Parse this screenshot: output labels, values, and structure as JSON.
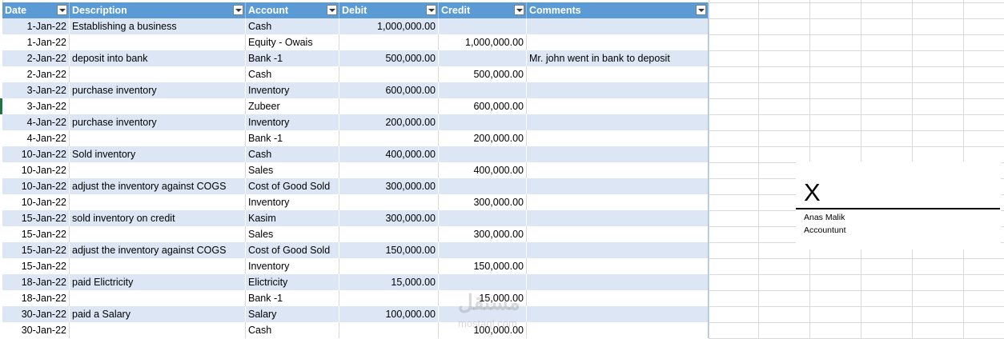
{
  "columns": [
    {
      "key": "date",
      "label": "Date"
    },
    {
      "key": "description",
      "label": "Description"
    },
    {
      "key": "account",
      "label": "Account"
    },
    {
      "key": "debit",
      "label": "Debit"
    },
    {
      "key": "credit",
      "label": "Credit"
    },
    {
      "key": "comments",
      "label": "Comments"
    }
  ],
  "rows": [
    {
      "date": "1-Jan-22",
      "description": "Establishing a business",
      "account": "Cash",
      "debit": "1,000,000.00",
      "credit": "",
      "comments": ""
    },
    {
      "date": "1-Jan-22",
      "description": "",
      "account": "Equity - Owais",
      "debit": "",
      "credit": "1,000,000.00",
      "comments": ""
    },
    {
      "date": "2-Jan-22",
      "description": "deposit into bank",
      "account": "Bank -1",
      "debit": "500,000.00",
      "credit": "",
      "comments": "Mr. john went in bank to deposit"
    },
    {
      "date": "2-Jan-22",
      "description": "",
      "account": "Cash",
      "debit": "",
      "credit": "500,000.00",
      "comments": ""
    },
    {
      "date": "3-Jan-22",
      "description": "purchase inventory",
      "account": "Inventory",
      "debit": "600,000.00",
      "credit": "",
      "comments": ""
    },
    {
      "date": "3-Jan-22",
      "description": "",
      "account": "Zubeer",
      "debit": "",
      "credit": "600,000.00",
      "comments": ""
    },
    {
      "date": "4-Jan-22",
      "description": "purchase inventory",
      "account": "Inventory",
      "debit": "200,000.00",
      "credit": "",
      "comments": ""
    },
    {
      "date": "4-Jan-22",
      "description": "",
      "account": "Bank -1",
      "debit": "",
      "credit": "200,000.00",
      "comments": ""
    },
    {
      "date": "10-Jan-22",
      "description": "Sold inventory",
      "account": "Cash",
      "debit": "400,000.00",
      "credit": "",
      "comments": ""
    },
    {
      "date": "10-Jan-22",
      "description": "",
      "account": "Sales",
      "debit": "",
      "credit": "400,000.00",
      "comments": ""
    },
    {
      "date": "10-Jan-22",
      "description": "adjust the inventory against COGS",
      "account": "Cost of Good Sold",
      "debit": "300,000.00",
      "credit": "",
      "comments": ""
    },
    {
      "date": "10-Jan-22",
      "description": "",
      "account": "Inventory",
      "debit": "",
      "credit": "300,000.00",
      "comments": ""
    },
    {
      "date": "15-Jan-22",
      "description": "sold inventory on credit",
      "account": "Kasim",
      "debit": "300,000.00",
      "credit": "",
      "comments": ""
    },
    {
      "date": "15-Jan-22",
      "description": "",
      "account": "Sales",
      "debit": "",
      "credit": "300,000.00",
      "comments": ""
    },
    {
      "date": "15-Jan-22",
      "description": "adjust the inventory against COGS",
      "account": "Cost of Good Sold",
      "debit": "150,000.00",
      "credit": "",
      "comments": ""
    },
    {
      "date": "15-Jan-22",
      "description": "",
      "account": "Inventory",
      "debit": "",
      "credit": "150,000.00",
      "comments": ""
    },
    {
      "date": "18-Jan-22",
      "description": "paid Elictricity",
      "account": "Elictricity",
      "debit": "15,000.00",
      "credit": "",
      "comments": ""
    },
    {
      "date": "18-Jan-22",
      "description": "",
      "account": "Bank -1",
      "debit": "",
      "credit": "15,000.00",
      "comments": ""
    },
    {
      "date": "30-Jan-22",
      "description": "paid a Salary",
      "account": "Salary",
      "debit": "100,000.00",
      "credit": "",
      "comments": ""
    },
    {
      "date": "30-Jan-22",
      "description": "",
      "account": "Cash",
      "debit": "",
      "credit": "100,000.00",
      "comments": ""
    }
  ],
  "signature": {
    "mark": "X",
    "name": "Anas Malik",
    "title": "Accountunt"
  },
  "watermark": {
    "main": "مستقل",
    "sub": "mostaql.com"
  },
  "colors": {
    "header": "#5b9bd5",
    "band": "#dce6f4",
    "grid": "#d9d9d9"
  },
  "icons": {
    "filter": "filter-dropdown-icon"
  }
}
